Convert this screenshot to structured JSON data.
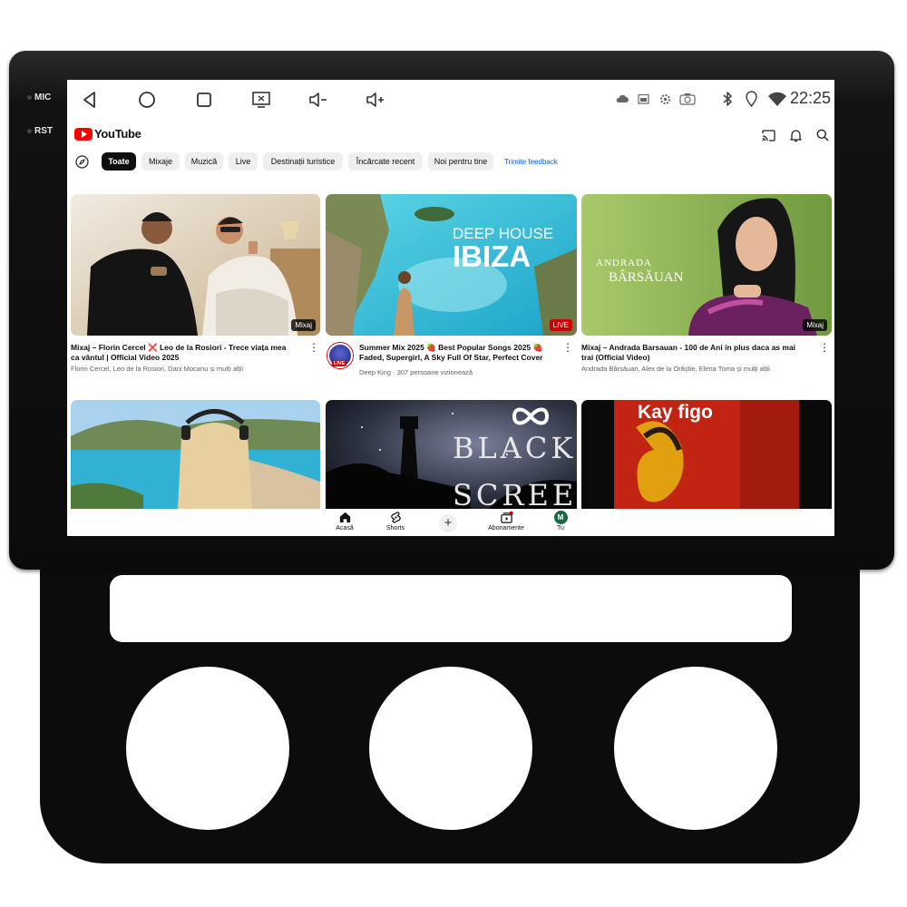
{
  "hardware": {
    "mic_label": "MIC",
    "rst_label": "RST"
  },
  "status_bar": {
    "time": "22:25"
  },
  "youtube": {
    "logo_text": "YouTube",
    "chips": [
      "Toate",
      "Mixaje",
      "Muzică",
      "Live",
      "Destinații turistice",
      "Încărcate recent",
      "Noi pentru tine"
    ],
    "feedback_link": "Trimite feedback",
    "videos": [
      {
        "title": "Mixaj – Florin Cercel ❌ Leo de la Rosiori - Trece viața mea ca vântul | Official Video 2025",
        "meta": "Florin Cercel, Leo de la Rosiori, Dani Mocanu și mulți alții",
        "badge": "Mixaj"
      },
      {
        "title": "Summer Mix 2025 🍓 Best Popular Songs 2025 🍓 Faded, Supergirl, A Sky Full Of Star, Perfect Cover",
        "meta": "Deep King · 307 persoane vizionează",
        "badge": "LIVE",
        "channel_badge": "LIVE",
        "thumb_title_small": "DEEP HOUSE",
        "thumb_title_big": "IBIZA"
      },
      {
        "title": "Mixaj – Andrada Barsauan - 100 de Ani in plus daca as mai trai (Official Video)",
        "meta": "Andrada Bârsăuan, Alex de la Orăștie, Elena Toma și mulți alții",
        "badge": "Mixaj",
        "thumb_title_small": "ANDRADA",
        "thumb_title_big": "BÂRSĂUAN"
      }
    ],
    "second_row": {
      "black_screen_line1": "BLACK",
      "black_screen_line2": "SCREEN",
      "kay_title": "Kay figo"
    },
    "bottom_nav": {
      "home": "Acasă",
      "shorts": "Shorts",
      "subscriptions": "Abonamente",
      "you": "Tu",
      "avatar_letter": "M"
    }
  },
  "colors": {
    "yt_red": "#ff0000",
    "link_blue": "#065fd4",
    "frame": "#0c0c0c"
  },
  "icons": [
    "back-icon",
    "home-icon",
    "recents-icon",
    "screenshot-icon",
    "volume-down-icon",
    "volume-up-icon",
    "cloud-icon",
    "cast-icon",
    "bell-icon",
    "search-icon",
    "compass-icon",
    "bluetooth-icon",
    "location-icon",
    "wifi-icon"
  ]
}
